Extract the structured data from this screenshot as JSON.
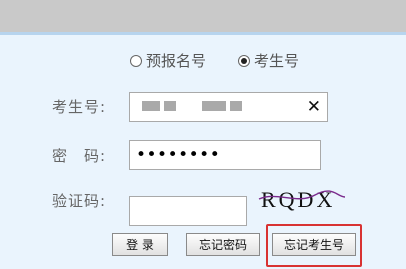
{
  "mode_options": [
    {
      "label": "预报名号",
      "selected": false
    },
    {
      "label": "考生号",
      "selected": true
    }
  ],
  "form": {
    "exam_number_label": "考生号:",
    "password_label": "密　码:",
    "password_value": "••••••••",
    "captcha_label": "验证码:",
    "captcha_input_value": "",
    "captcha_image_text": "RQDX"
  },
  "buttons": {
    "login": "登 录",
    "forgot_password": "忘记密码",
    "forgot_exam_number": "忘记考生号"
  },
  "colors": {
    "background": "#eaf4fd",
    "highlight_border": "#d83232"
  },
  "icons": {
    "clear": "close-icon"
  }
}
